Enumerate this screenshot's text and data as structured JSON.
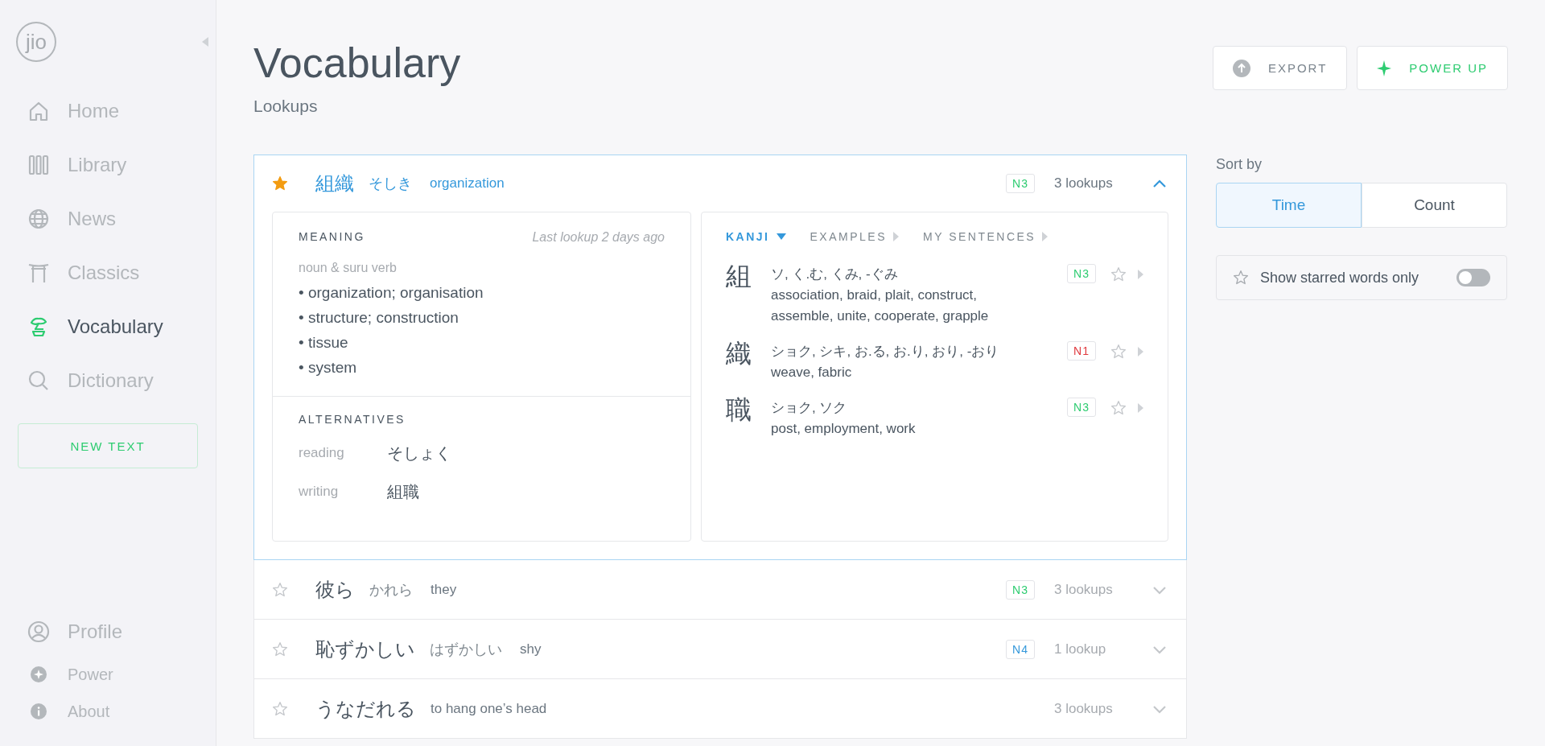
{
  "sidebar": {
    "logo": "jio",
    "nav": [
      {
        "label": "Home",
        "selected": false
      },
      {
        "label": "Library",
        "selected": false
      },
      {
        "label": "News",
        "selected": false
      },
      {
        "label": "Classics",
        "selected": false
      },
      {
        "label": "Vocabulary",
        "selected": true
      },
      {
        "label": "Dictionary",
        "selected": false
      }
    ],
    "new_text_button": "NEW TEXT",
    "footer": [
      {
        "label": "Profile"
      },
      {
        "label": "Power"
      },
      {
        "label": "About"
      }
    ]
  },
  "header": {
    "title": "Vocabulary",
    "subtitle": "Lookups",
    "buttons": [
      {
        "label": "EXPORT",
        "kind": "export"
      },
      {
        "label": "POWER UP",
        "kind": "power"
      }
    ]
  },
  "words": [
    {
      "starred": true,
      "expanded": true,
      "word": "組織",
      "reading": "そしき",
      "meaning": "organization",
      "badge": {
        "text": "N3",
        "color": "#2ecc71"
      },
      "lookups": "3 lookups",
      "details": {
        "meaning_heading": "MEANING",
        "last_lookup": "Last lookup 2 days ago",
        "pos": "noun & suru verb",
        "senses": [
          "• organization; organisation",
          "• structure; construction",
          "• tissue",
          "• system"
        ],
        "alternatives_heading": "ALTERNATIVES",
        "alternatives": [
          {
            "label": "reading",
            "value": "そしょく"
          },
          {
            "label": "writing",
            "value": "組職"
          }
        ],
        "tabs": [
          {
            "label": "KANJI",
            "selected": true
          },
          {
            "label": "EXAMPLES",
            "selected": false
          },
          {
            "label": "MY SENTENCES",
            "selected": false
          }
        ],
        "kanji": [
          {
            "kanji": "組",
            "readings": "ソ, く.む, くみ, -ぐみ",
            "meanings": "association, braid, plait, construct, assemble, unite, cooperate, grapple",
            "badge": {
              "text": "N3",
              "color": "#2ecc71"
            },
            "starred": false
          },
          {
            "kanji": "織",
            "readings": "ショク, シキ, お.る, お.り, おり, -おり",
            "meanings": "weave, fabric",
            "badge": {
              "text": "N1",
              "color": "#e0393e"
            },
            "starred": false
          },
          {
            "kanji": "職",
            "readings": "ショク, ソク",
            "meanings": "post, employment, work",
            "badge": {
              "text": "N3",
              "color": "#2ecc71"
            },
            "starred": false
          }
        ]
      }
    },
    {
      "starred": false,
      "expanded": false,
      "word": "彼ら",
      "reading": "かれら",
      "meaning": "they",
      "badge": {
        "text": "N3",
        "color": "#2ecc71"
      },
      "lookups": "3 lookups"
    },
    {
      "starred": false,
      "expanded": false,
      "word": "恥ずかしい",
      "reading": "はずかしい",
      "meaning": "shy",
      "badge": {
        "text": "N4",
        "color": "#3498db"
      },
      "lookups": "1 lookup"
    },
    {
      "starred": false,
      "expanded": false,
      "word": "うなだれる",
      "meaning": "to hang one’s head",
      "lookups": "3 lookups"
    }
  ],
  "side": {
    "sort_label": "Sort by",
    "sort_options": [
      {
        "label": "Time",
        "selected": true
      },
      {
        "label": "Count",
        "selected": false
      }
    ],
    "starred_filter": {
      "label": "Show starred words only",
      "on": false
    }
  }
}
